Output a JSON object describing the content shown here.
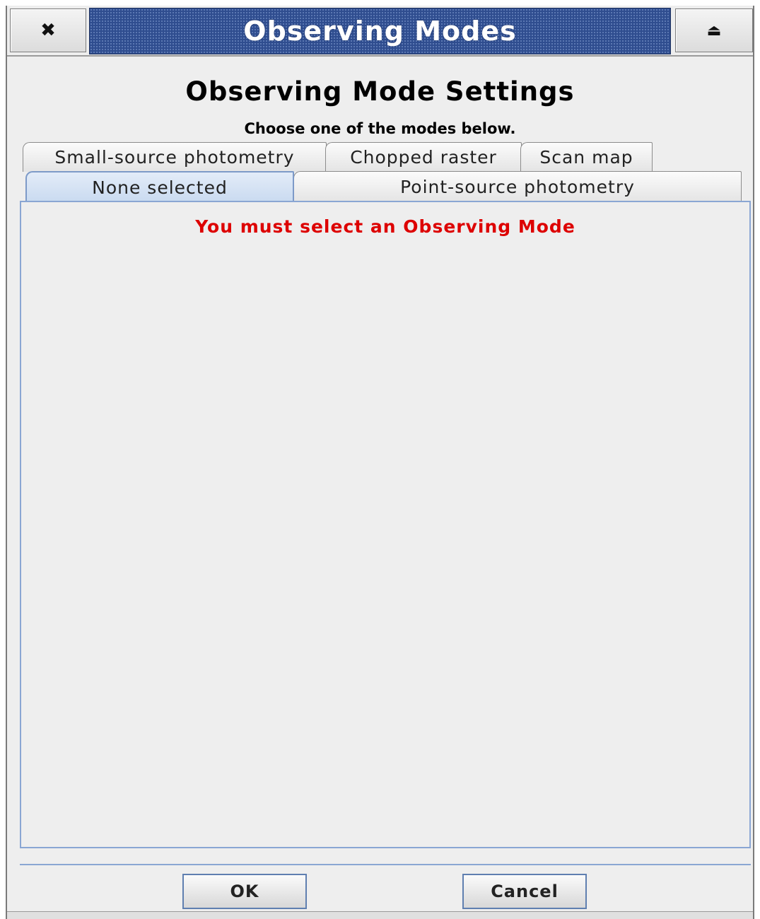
{
  "window": {
    "title": "Observing Modes",
    "close_glyph": "✖",
    "shade_glyph": "⏏",
    "close_icon": "close-icon",
    "shade_icon": "eject-icon"
  },
  "header": {
    "heading": "Observing Mode Settings",
    "subheading": "Choose one of the modes below."
  },
  "tabs": {
    "row_back": [
      {
        "label": "Small-source photometry"
      },
      {
        "label": "Chopped raster"
      },
      {
        "label": "Scan map"
      }
    ],
    "row_front": [
      {
        "label": "None selected",
        "selected": true
      },
      {
        "label": "Point-source photometry",
        "selected": false
      }
    ]
  },
  "panel": {
    "warning": "You must select an Observing Mode",
    "warning_color": "#dd0000"
  },
  "buttons": {
    "ok": "OK",
    "cancel": "Cancel"
  },
  "colors": {
    "titlebar": "#2f4d8f",
    "selected_tab": "#c9daf0",
    "accent_border": "#8aa6d3"
  }
}
